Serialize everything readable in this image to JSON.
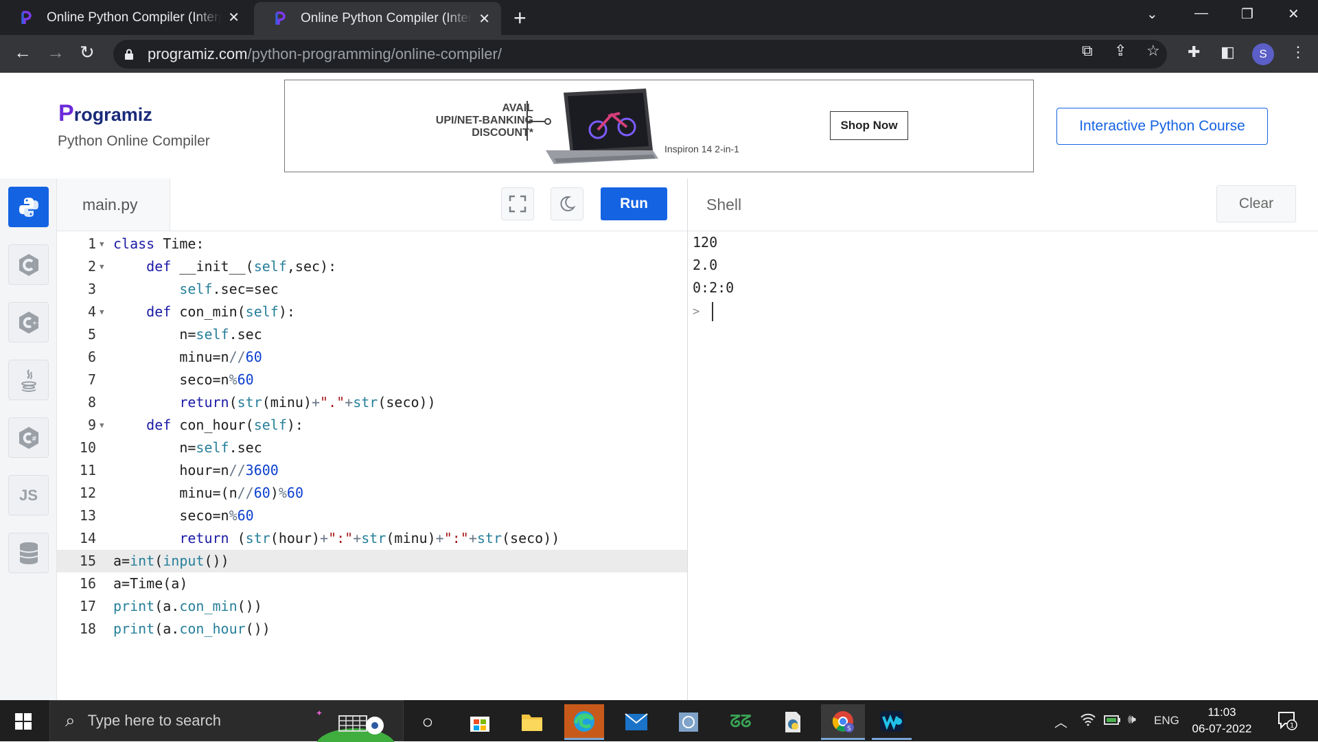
{
  "browser": {
    "tabs": [
      {
        "title": "Online Python Compiler (Interpreter)",
        "active": false
      },
      {
        "title": "Online Python Compiler (Interpreter)",
        "active": true
      }
    ],
    "url_domain": "programiz.com",
    "url_path": "/python-programming/online-compiler/",
    "profile_initial": "S"
  },
  "header": {
    "logo_p": "P",
    "logo_rest": "rogramiz",
    "subtitle": "Python Online Compiler",
    "course_button": "Interactive Python Course"
  },
  "ad": {
    "line1": "AVAIL",
    "line2": "UPI/NET-BANKING",
    "line3": "DISCOUNT*",
    "model": "Inspiron 14 2-in-1",
    "cta": "Shop Now"
  },
  "sidebar": {
    "languages": [
      "python",
      "c",
      "cpp",
      "java",
      "csharp",
      "javascript",
      "sql"
    ],
    "js_label": "JS"
  },
  "editor": {
    "filename": "main.py",
    "run_label": "Run",
    "active_line": 15,
    "lines": [
      {
        "n": "1",
        "fold": true,
        "html": "<span class='kw'>class</span> Time:"
      },
      {
        "n": "2",
        "fold": true,
        "html": "    <span class='kw'>def</span> __init__(<span class='sf'>self</span>,sec):"
      },
      {
        "n": "3",
        "fold": false,
        "html": "        <span class='sf'>self</span>.sec=sec"
      },
      {
        "n": "4",
        "fold": true,
        "html": "    <span class='kw'>def</span> con_min(<span class='sf'>self</span>):"
      },
      {
        "n": "5",
        "fold": false,
        "html": "        n=<span class='sf'>self</span>.sec"
      },
      {
        "n": "6",
        "fold": false,
        "html": "        minu=n<span class='op'>//</span><span class='num'>60</span>"
      },
      {
        "n": "7",
        "fold": false,
        "html": "        seco=n<span class='op'>%</span><span class='num'>60</span>"
      },
      {
        "n": "8",
        "fold": false,
        "html": "        <span class='kw'>return</span>(<span class='bi'>str</span>(minu)<span class='op'>+</span><span class='st'>\".\"</span><span class='op'>+</span><span class='bi'>str</span>(seco))"
      },
      {
        "n": "9",
        "fold": true,
        "html": "    <span class='kw'>def</span> con_hour(<span class='sf'>self</span>):"
      },
      {
        "n": "10",
        "fold": false,
        "html": "        n=<span class='sf'>self</span>.sec"
      },
      {
        "n": "11",
        "fold": false,
        "html": "        hour=n<span class='op'>//</span><span class='num'>3600</span>"
      },
      {
        "n": "12",
        "fold": false,
        "html": "        minu=(n<span class='op'>//</span><span class='num'>60</span>)<span class='op'>%</span><span class='num'>60</span>"
      },
      {
        "n": "13",
        "fold": false,
        "html": "        seco=n<span class='op'>%</span><span class='num'>60</span>"
      },
      {
        "n": "14",
        "fold": false,
        "html": "        <span class='kw'>return</span> (<span class='bi'>str</span>(hour)<span class='op'>+</span><span class='st'>\":\"</span><span class='op'>+</span><span class='bi'>str</span>(minu)<span class='op'>+</span><span class='st'>\":\"</span><span class='op'>+</span><span class='bi'>str</span>(seco))"
      },
      {
        "n": "15",
        "fold": false,
        "html": "a=<span class='bi'>int</span>(<span class='bi'>input</span>())"
      },
      {
        "n": "16",
        "fold": false,
        "html": "a=Time(a)"
      },
      {
        "n": "17",
        "fold": false,
        "html": "<span class='bi'>print</span>(a.<span class='bi'>con_min</span>())"
      },
      {
        "n": "18",
        "fold": false,
        "html": "<span class='bi'>print</span>(a.<span class='bi'>con_hour</span>())"
      }
    ]
  },
  "shell": {
    "title": "Shell",
    "clear_label": "Clear",
    "output": [
      "120",
      "2.0",
      "0:2:0"
    ],
    "prompt": ">"
  },
  "taskbar": {
    "search_placeholder": "Type here to search",
    "language": "ENG",
    "time": "11:03",
    "date": "06-07-2022",
    "notification_count": "1"
  },
  "colors": {
    "accent": "#1463e3",
    "keyword": "#1a1aa6",
    "self": "#267f99",
    "number": "#0b3fd1",
    "string": "#a31515"
  }
}
